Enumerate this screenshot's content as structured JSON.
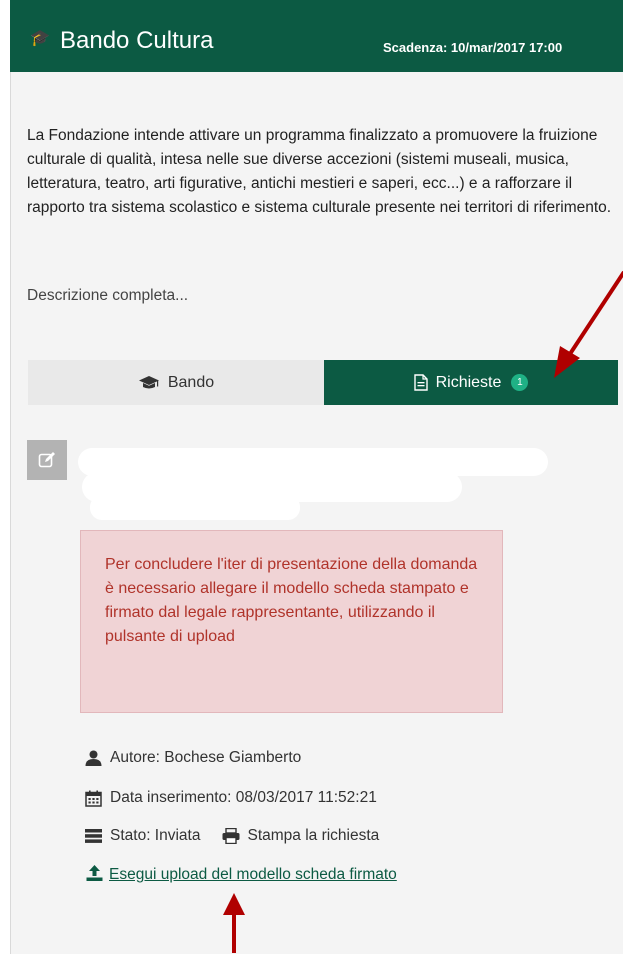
{
  "header": {
    "title": "Bando Cultura",
    "deadline": "Scadenza: 10/mar/2017 17:00"
  },
  "description": {
    "text": "La Fondazione intende attivare un programma finalizzato a promuovere la fruizione culturale di qualità, intesa nelle sue diverse accezioni (sistemi museali, musica, letteratura, teatro, arti figurative, antichi mestieri e saperi, ecc...) e a rafforzare il rapporto tra sistema scolastico e sistema culturale presente nei territori di riferimento.",
    "more_link": "Descrizione completa..."
  },
  "tabs": [
    {
      "label": "Bando",
      "icon": "graduation-cap-icon",
      "active": false
    },
    {
      "label": "Richieste",
      "icon": "document-icon",
      "active": true,
      "badge": "1"
    }
  ],
  "alert": {
    "text": "Per concludere l'iter di presentazione della domanda è necessario allegare il modello scheda stampato e firmato dal legale rappresentante, utilizzando il pulsante di upload"
  },
  "meta": {
    "author": "Autore: Bochese Giamberto",
    "date": "Data inserimento: 08/03/2017 11:52:21",
    "status": "Stato: Inviata",
    "print_link": "Stampa la richiesta",
    "upload_link": "Esegui upload del modello scheda firmato"
  },
  "colors": {
    "brand": "#0c5a43",
    "badge": "#1fb185",
    "alert_bg": "#f0d3d5",
    "alert_text": "#b0332a",
    "annotation_arrow": "#b00000"
  }
}
